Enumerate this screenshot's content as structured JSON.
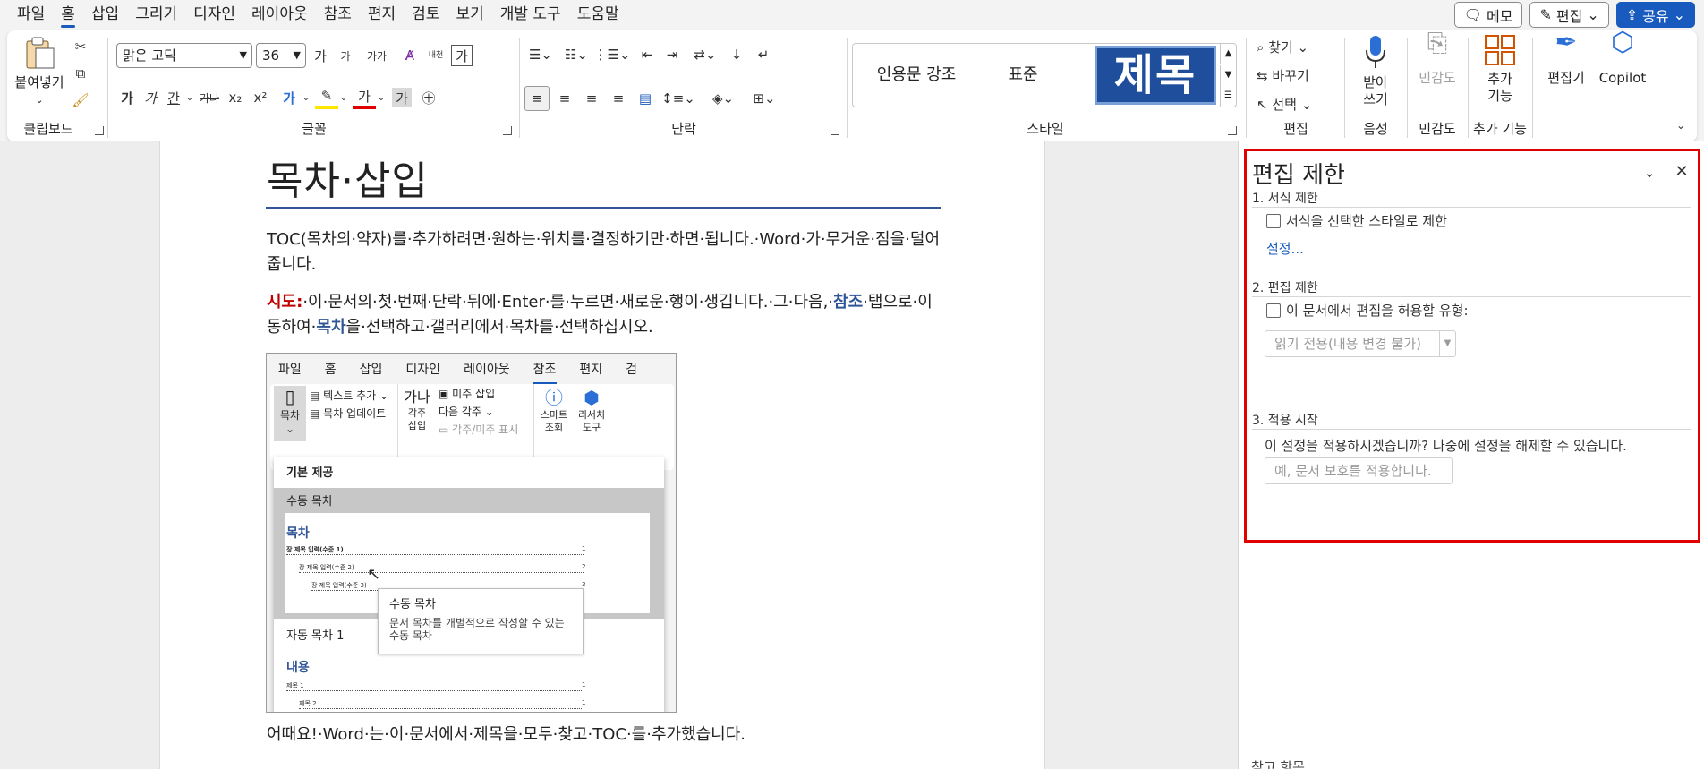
{
  "menu": {
    "tabs": [
      "파일",
      "홈",
      "삽입",
      "그리기",
      "디자인",
      "레이아웃",
      "참조",
      "편지",
      "검토",
      "보기",
      "개발 도구",
      "도움말"
    ],
    "active_tab": "홈",
    "memo_label": "메모",
    "edit_label": "편집",
    "share_label": "공유"
  },
  "ribbon": {
    "clipboard": {
      "paste_label": "붙여넣기",
      "group_label": "클립보드"
    },
    "font": {
      "font_name": "맑은 고딕",
      "font_size": "36",
      "group_label": "글꼴",
      "size_up": "가",
      "size_down": "가",
      "case": "가가",
      "char_border": "가",
      "bold": "가",
      "italic": "가",
      "underline": "간",
      "strike": "가나",
      "subscript": "x₂",
      "superscript": "x²",
      "effects": "가",
      "color": "가",
      "shading": "가",
      "enclose": "㊉",
      "pinyin": "내천",
      "letter_box": "가"
    },
    "paragraph": {
      "group_label": "단락"
    },
    "styles": {
      "items": [
        "인용문 강조",
        "표준",
        "제목"
      ],
      "group_label": "스타일"
    },
    "editing": {
      "find": "찾기",
      "replace": "바꾸기",
      "select": "선택",
      "group_label": "편집"
    },
    "voice": {
      "dictate": "받아 쓰기",
      "group_label": "음성"
    },
    "sensitivity": {
      "label": "민감도",
      "group_label": "민감도"
    },
    "addins": {
      "label": "추가 기능",
      "group_label": "추가 기능"
    },
    "editor": {
      "label": "편집기"
    },
    "copilot": {
      "label": "Copilot"
    }
  },
  "doc": {
    "title": "목차·삽입",
    "para1": "TOC(목차의·약자)를·추가하려면·원하는·위치를·결정하기만·하면·됩니다.·Word·가·무거운·짐을·덜어줍니다.",
    "para2_prefix": "시도:",
    "para2_a": "·이·문서의·첫·번째·단락·뒤에·Enter·를·누르면·새로운·행이·생깁니다.·그·다음,·",
    "para2_ref": "참조",
    "para2_b": "·탭으로·이동하여·",
    "para2_toc": "목차",
    "para2_c": "을·선택하고·갤러리에서·목차를·선택하십시오.",
    "para3": "어때요!·Word·는·이·문서에서·제목을·모두·찾고·TOC·를·추가했습니다."
  },
  "screenshot": {
    "tabs": [
      "파일",
      "홈",
      "삽입",
      "디자인",
      "레이아웃",
      "참조",
      "편지",
      "검"
    ],
    "active_tab": "참조",
    "toc_btn": "목차",
    "add_text": "텍스트 추가",
    "update_toc": "목차 업데이트",
    "footnote_insert": "각주 삽입",
    "endnote_insert": "미주 삽입",
    "next_footnote": "다음 각주",
    "show_notes": "각주/미주 표시",
    "smart_lookup": "스마트 조회",
    "researcher": "리서치 도구",
    "ga_na": "가나",
    "builtin": "기본 제공",
    "manual_toc": "수동 목차",
    "toc_heading": "목차",
    "toc_lines": [
      "장 제목 입력(수준 1)",
      "장 제목 입력(수준 2)",
      "장 제목 입력(수준 3)"
    ],
    "toc_pages": [
      "1",
      "2",
      "3"
    ],
    "auto_toc1": "자동 목차 1",
    "content_heading": "내용",
    "content_lines": [
      "제목 1",
      "제목 2"
    ],
    "content_pages": [
      "1",
      "1"
    ],
    "tip_title": "수동 목차",
    "tip_body": "문서 목차를 개별적으로 작성할 수 있는 수동 목차"
  },
  "pane": {
    "title": "편집 제한",
    "sec1": "1. 서식 제한",
    "sec1_check": "서식을 선택한 스타일로 제한",
    "sec1_link": "설정...",
    "sec2": "2. 편집 제한",
    "sec2_check": "이 문서에서 편집을 허용할 유형:",
    "sec2_select": "읽기 전용(내용 변경 불가)",
    "sec3": "3. 적용 시작",
    "sec3_text": "이 설정을 적용하시겠습니까? 나중에 설정을 해제할 수 있습니다.",
    "sec3_button": "예, 문서 보호를 적용합니다.",
    "footer": "참고 항목"
  },
  "colors": {
    "accent": "#185abd",
    "highlight_box": "#e00000",
    "title_rule": "#2f5597"
  }
}
